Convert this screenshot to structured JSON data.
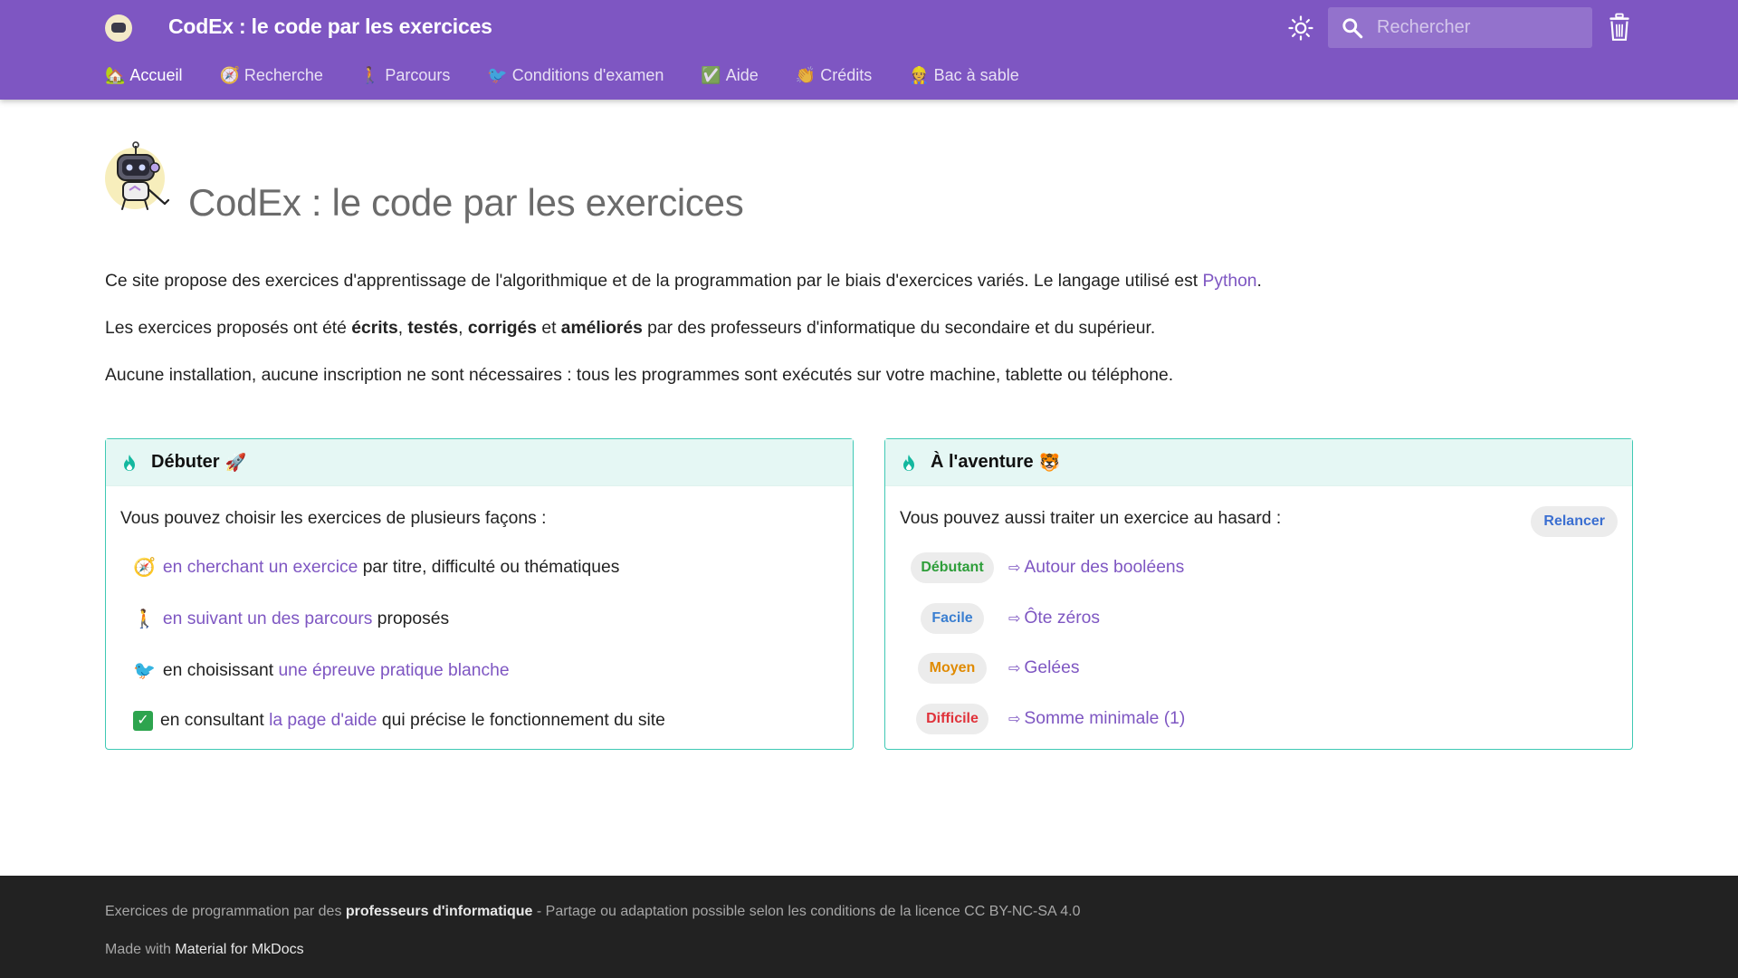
{
  "header": {
    "title": "CodEx : le code par les exercices",
    "search_placeholder": "Rechercher",
    "accent_color": "#7e56c2"
  },
  "tabs": [
    {
      "icon": "house-icon",
      "emoji": "🏡",
      "label": "Accueil",
      "active": true
    },
    {
      "icon": "compass-icon",
      "emoji": "🧭",
      "label": "Recherche",
      "active": false
    },
    {
      "icon": "person-walking-icon",
      "emoji": "🚶",
      "label": "Parcours",
      "active": false
    },
    {
      "icon": "bird-icon",
      "emoji": "🐦",
      "label": "Conditions d'examen",
      "active": false
    },
    {
      "icon": "check-icon",
      "emoji": "✅",
      "label": "Aide",
      "active": false
    },
    {
      "icon": "clapping-hands-icon",
      "emoji": "👏",
      "label": "Crédits",
      "active": false
    },
    {
      "icon": "construction-worker-icon",
      "emoji": "👷",
      "label": "Bac à sable",
      "active": false
    }
  ],
  "page": {
    "title": "CodEx : le code par les exercices",
    "p1": {
      "text": "Ce site propose des exercices d'apprentissage de l'algorithmique et de la programmation par le biais d'exercices variés. Le langage utilisé est ",
      "link": "Python",
      "end": "."
    },
    "p2": {
      "t1": "Les exercices proposés ont été ",
      "b1": "écrits",
      "s1": ", ",
      "b2": "testés",
      "s2": ", ",
      "b3": "corrigés",
      "s3": " et ",
      "b4": "améliorés",
      "t2": " par des professeurs d'informatique du secondaire et du supérieur."
    },
    "p3": "Aucune installation, aucune inscription ne sont nécessaires : tous les programmes sont exécutés sur votre machine, tablette ou téléphone."
  },
  "card_start": {
    "title": "Débuter",
    "title_emoji": "🚀",
    "intro": "Vous pouvez choisir les exercices de plusieurs façons :",
    "ways": [
      {
        "icon": "compass-icon",
        "emoji": "🧭",
        "pre": "",
        "link": "en cherchant un exercice",
        "post": " par titre, difficulté ou thématiques"
      },
      {
        "icon": "person-walking-icon",
        "emoji": "🚶",
        "pre": "",
        "link": "en suivant un des parcours",
        "post": " proposés"
      },
      {
        "icon": "bird-icon",
        "emoji": "🐦",
        "pre": "en choisissant ",
        "link": "une épreuve pratique blanche",
        "post": ""
      },
      {
        "icon": "check-icon",
        "emoji": "✓",
        "pre": "en consultant ",
        "link": "la page d'aide",
        "post": " qui précise le fonctionnement du site"
      }
    ]
  },
  "card_adventure": {
    "title": "À l'aventure",
    "title_emoji": "🐯",
    "intro": "Vous pouvez aussi traiter un exercice au hasard :",
    "reroll_label": "Relancer",
    "exercises": [
      {
        "level": "Débutant",
        "color": "#2e9e3a",
        "title": "Autour des booléens"
      },
      {
        "level": "Facile",
        "color": "#3b7fd1",
        "title": "Ôte zéros"
      },
      {
        "level": "Moyen",
        "color": "#e08a00",
        "title": "Gelées"
      },
      {
        "level": "Difficile",
        "color": "#e0323a",
        "title": "Somme minimale (1)"
      }
    ],
    "arrow": "⇨"
  },
  "footer": {
    "l1_pre": "Exercices de programmation par des ",
    "l1_bold": "professeurs d'informatique",
    "l1_post": " - Partage ou adaptation possible selon les conditions de la licence CC BY-NC-SA 4.0",
    "l2_pre": "Made with ",
    "l2_link": "Material for MkDocs"
  }
}
